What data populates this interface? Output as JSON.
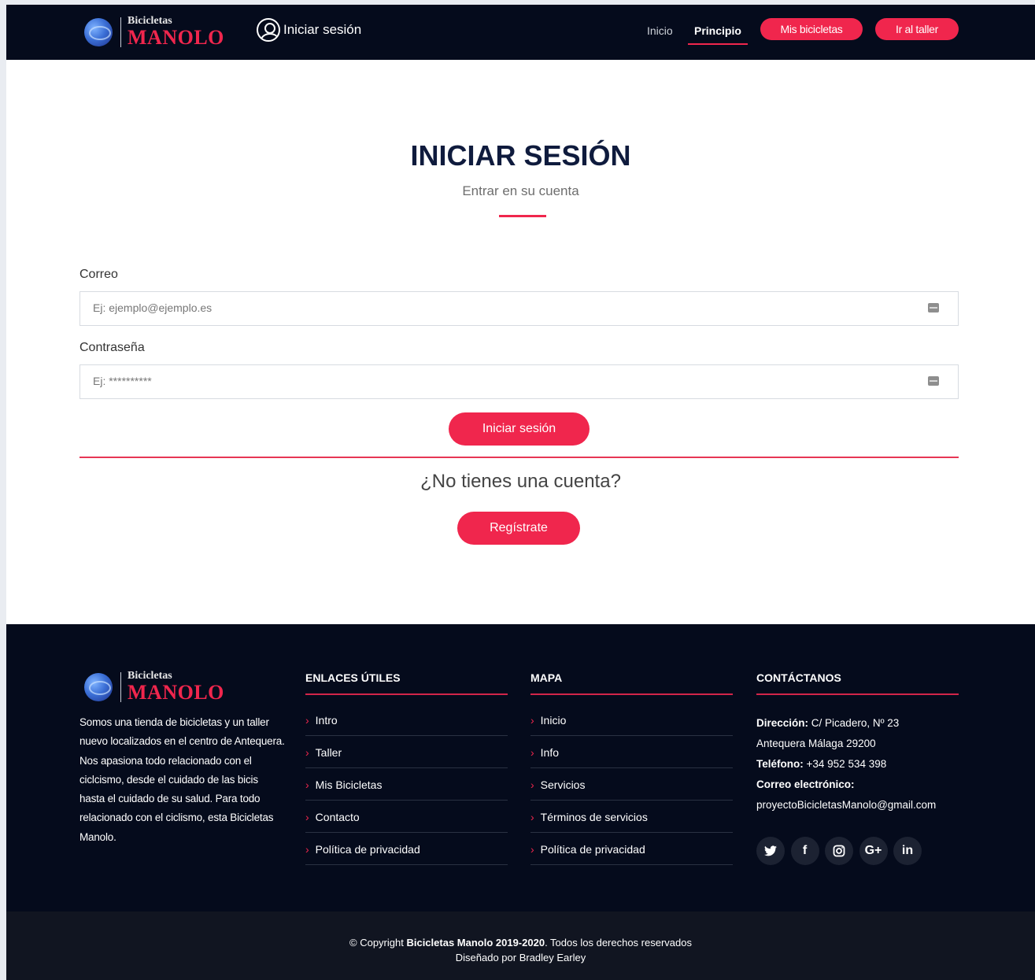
{
  "brand": {
    "small": "Bicicletas",
    "big": "MANOLO",
    "accent": "#f0264d",
    "dark": "#050b1c"
  },
  "header": {
    "login_label": "Iniciar sesión",
    "nav": {
      "inicio": "Inicio",
      "principio": "Principio",
      "mis_bicicletas": "Mis bicicletas",
      "ir_al_taller": "Ir al taller"
    }
  },
  "main": {
    "title": "INICIAR SESIÓN",
    "subtitle": "Entrar en su cuenta",
    "email_label": "Correo",
    "email_placeholder": "Ej: ejemplo@ejemplo.es",
    "password_label": "Contraseña",
    "password_placeholder": "Ej: **********",
    "login_button": "Iniciar sesión",
    "no_account": "¿No tienes una cuenta?",
    "register_button": "Regístrate"
  },
  "footer": {
    "about": "Somos una tienda de bicicletas y un taller nuevo localizados en el centro de Antequera. Nos apasiona todo relacionado con el ciclcismo, desde el cuidado de las bicis hasta el cuidado de su salud. Para todo relacionado con el ciclismo, esta Bicicletas Manolo.",
    "useful_links": {
      "heading": "ENLACES ÚTILES",
      "items": [
        "Intro",
        "Taller",
        "Mis Bicicletas",
        "Contacto",
        "Política de privacidad"
      ]
    },
    "map": {
      "heading": "MAPA",
      "items": [
        "Inicio",
        "Info",
        "Servicios",
        "Términos de servicios",
        "Política de privacidad"
      ]
    },
    "contact": {
      "heading": "CONTÁCTANOS",
      "address_label": "Dirección:",
      "address_line1": "C/ Picadero, Nº 23",
      "address_line2": "Antequera Málaga 29200",
      "phone_label": "Teléfono:",
      "phone": "+34 952 534 398",
      "email_label": "Correo electrónico:",
      "email": "proyectoBicicletasManolo@gmail.com"
    },
    "socials": [
      {
        "icon": "twitter-icon",
        "glyph": "🐦"
      },
      {
        "icon": "facebook-icon",
        "glyph": "f"
      },
      {
        "icon": "instagram-icon",
        "glyph": "◎"
      },
      {
        "icon": "google-plus-icon",
        "glyph": "G+"
      },
      {
        "icon": "linkedin-icon",
        "glyph": "in"
      }
    ],
    "copyright_prefix": "© Copyright ",
    "copyright_brand": "Bicicletas Manolo 2019-2020",
    "copyright_suffix": ". Todos los derechos reservados",
    "designed_by": "Diseñado por Bradley Earley"
  }
}
